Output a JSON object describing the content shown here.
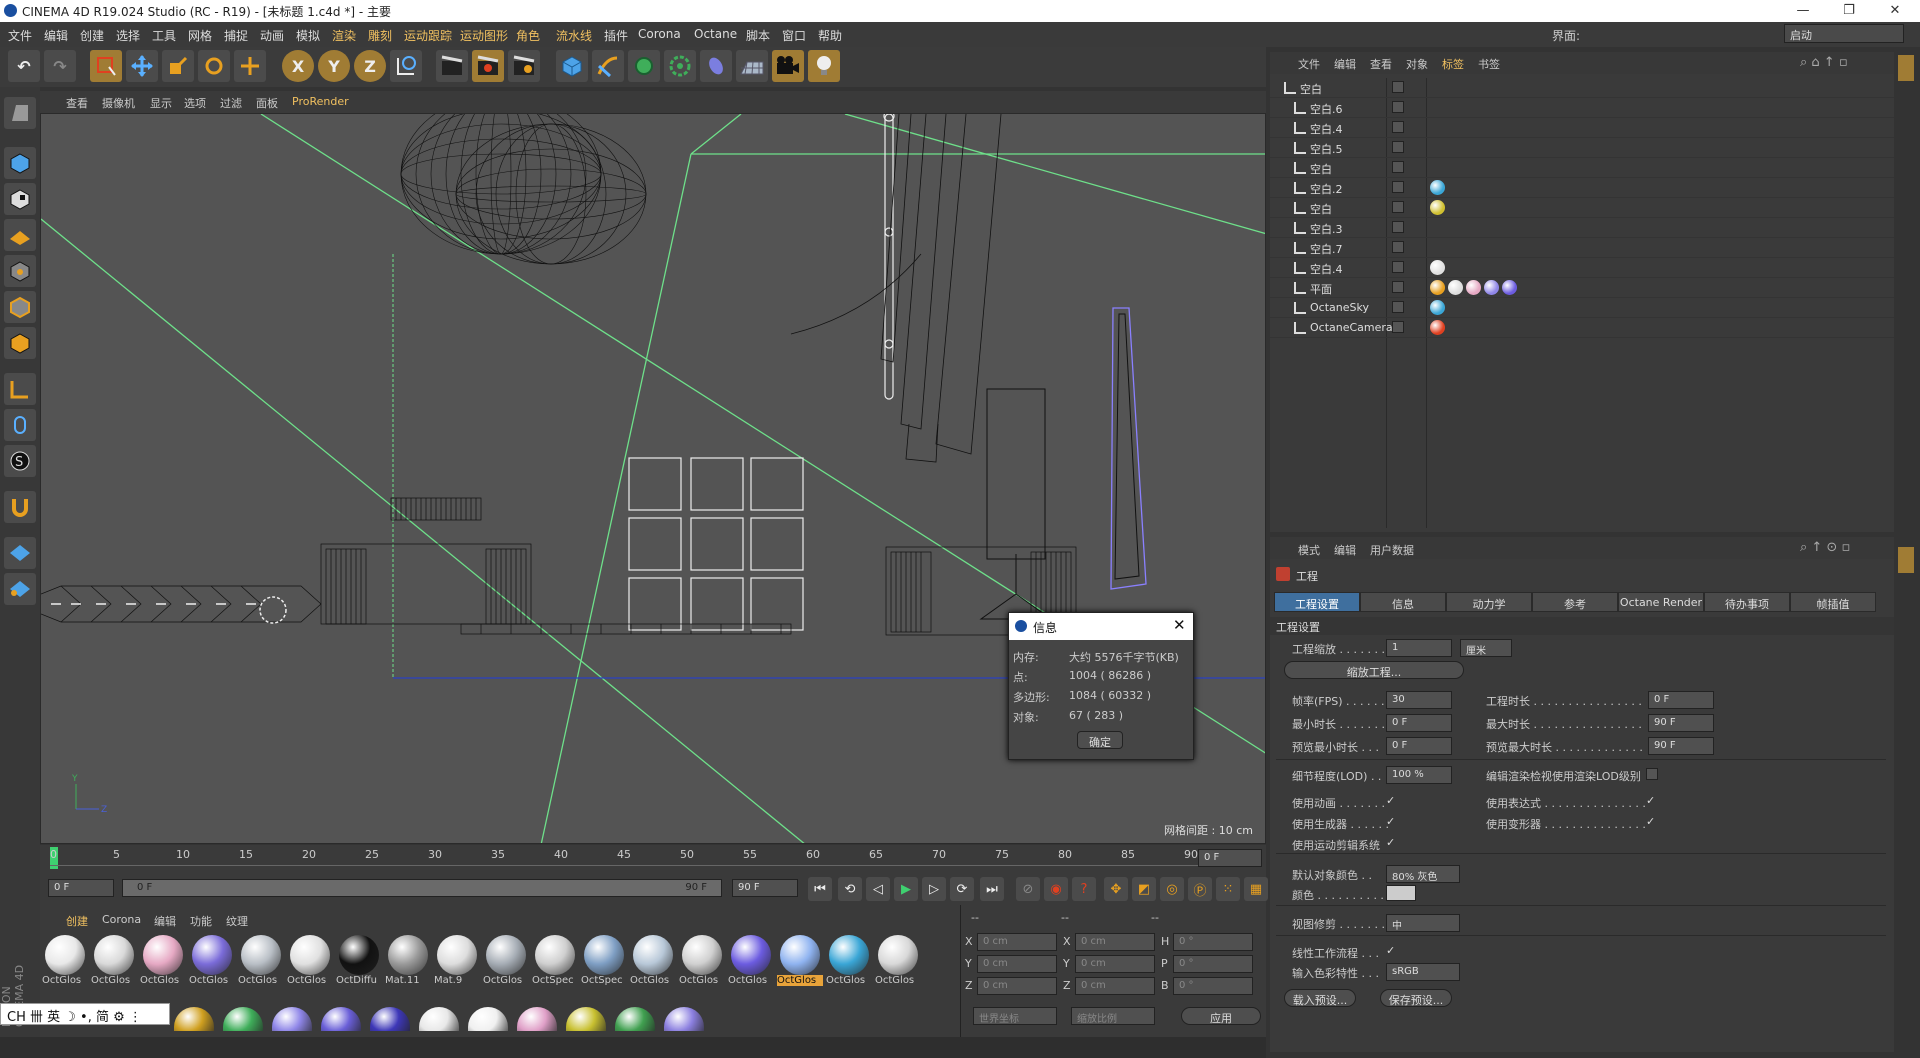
{
  "window": {
    "title": "CINEMA 4D R19.024 Studio (RC - R19) - [未标题 1.c4d *] - 主要",
    "minimize": "—",
    "restore": "❐",
    "close": "✕"
  },
  "menubar": {
    "items": [
      "文件",
      "编辑",
      "创建",
      "选择",
      "工具",
      "网格",
      "捕捉",
      "动画",
      "模拟",
      "渲染",
      "雕刻",
      "运动跟踪",
      "运动图形",
      "角色",
      "流水线",
      "插件",
      "Corona",
      "Octane",
      "脚本",
      "窗口",
      "帮助"
    ],
    "layout_label": "界面:",
    "layout_value": "启动"
  },
  "toolbar": {
    "undo": "↶",
    "redo": "↷",
    "x_axis": "X",
    "y_axis": "Y",
    "z_axis": "Z"
  },
  "viewport": {
    "menu": [
      "查看",
      "摄像机",
      "显示",
      "选项",
      "过滤",
      "面板",
      "ProRender"
    ],
    "grid_spacing": "网格间距 : 10 cm",
    "axis_y": "Y",
    "axis_z": "Z"
  },
  "timeline": {
    "ticks": [
      "0",
      "5",
      "10",
      "15",
      "20",
      "25",
      "30",
      "35",
      "40",
      "45",
      "50",
      "55",
      "60",
      "65",
      "70",
      "75",
      "80",
      "85",
      "90"
    ],
    "current_frame": "0 F",
    "start": "0 F",
    "range_start": "0 F",
    "range_end": "90 F",
    "end": "90 F"
  },
  "material_manager": {
    "tabs": [
      "创建",
      "Corona",
      "编辑",
      "功能",
      "纹理"
    ],
    "materials": [
      {
        "name": "OctGlos",
        "color": "#e8e8e8"
      },
      {
        "name": "OctGlos",
        "color": "#d9d9d9"
      },
      {
        "name": "OctGlos",
        "color": "#e6a9c4"
      },
      {
        "name": "OctGlos",
        "color": "#7b6cd9"
      },
      {
        "name": "OctGlos",
        "color": "#b9bfc6"
      },
      {
        "name": "OctGlos",
        "color": "#e0e0e0"
      },
      {
        "name": "OctDiffu",
        "color": "#111111"
      },
      {
        "name": "Mat.11",
        "color": "#9a9a9a"
      },
      {
        "name": "Mat.9",
        "color": "#dddddd"
      },
      {
        "name": "OctGlos",
        "color": "#a6adb5"
      },
      {
        "name": "OctSpec",
        "color": "#cfcfcf"
      },
      {
        "name": "OctSpec",
        "color": "#7f9fc4"
      },
      {
        "name": "OctGlos",
        "color": "#b8c8d8"
      },
      {
        "name": "OctGlos",
        "color": "#d0d0d0"
      },
      {
        "name": "OctGlos",
        "color": "#6c5ce0"
      },
      {
        "name": "OctGlos",
        "color": "#8fb3f0"
      },
      {
        "name": "OctGlos",
        "color": "#3aa6d6"
      },
      {
        "name": "OctGlos",
        "color": "#d8d8d8"
      }
    ],
    "row2_colors": [
      "#d0a020",
      "#3fae5a",
      "#8f86e8",
      "#6a5fd8",
      "#3d37b8",
      "#e8e8e8",
      "#f0f0f0",
      "#e0a0c8",
      "#c8c030",
      "#40a050",
      "#8c80e0"
    ]
  },
  "coordinates": {
    "headers": [
      "--",
      "--",
      "--"
    ],
    "rows": [
      {
        "a": "X",
        "av": "0 cm",
        "b": "X",
        "bv": "0 cm",
        "c": "H",
        "cv": "0 °"
      },
      {
        "a": "Y",
        "av": "0 cm",
        "b": "Y",
        "bv": "0 cm",
        "c": "P",
        "cv": "0 °"
      },
      {
        "a": "Z",
        "av": "0 cm",
        "b": "Z",
        "bv": "0 cm",
        "c": "B",
        "cv": "0 °"
      }
    ],
    "mode1": "世界坐标",
    "mode2": "缩放比例",
    "apply": "应用"
  },
  "ime": {
    "text": "CH 卌 英 ☽ •, 简 ⚙ ⋮"
  },
  "object_manager": {
    "menu": [
      "文件",
      "编辑",
      "查看",
      "对象",
      "标签",
      "书签"
    ],
    "objects": [
      {
        "name": "空白",
        "depth": 0
      },
      {
        "name": "空白.6",
        "depth": 1
      },
      {
        "name": "空白.4",
        "depth": 1
      },
      {
        "name": "空白.5",
        "depth": 1
      },
      {
        "name": "空白",
        "depth": 1
      },
      {
        "name": "空白.2",
        "depth": 1
      },
      {
        "name": "空白",
        "depth": 1
      },
      {
        "name": "空白.3",
        "depth": 1
      },
      {
        "name": "空白.7",
        "depth": 1
      },
      {
        "name": "空白.4",
        "depth": 1
      },
      {
        "name": "平面",
        "depth": 1
      },
      {
        "name": "OctaneSky",
        "depth": 1
      },
      {
        "name": "OctaneCamera",
        "depth": 1
      }
    ]
  },
  "attribute_manager": {
    "menu": [
      "模式",
      "编辑",
      "用户数据"
    ],
    "title": "工程",
    "tabs": [
      "工程设置",
      "信息",
      "动力学",
      "参考",
      "Octane Render",
      "待办事项",
      "帧插值"
    ],
    "section": "工程设置",
    "scale_label": "工程缩放 . . . . . . . .",
    "scale_value": "1",
    "scale_unit": "厘米",
    "scale_button": "缩放工程...",
    "fps_label": "帧率(FPS) . . . . . .",
    "fps_value": "30",
    "time_label": "工程时长 . . . . . . . . . . . . . . . .",
    "time_value": "0 F",
    "min_label": "最小时长 . . . . . . .",
    "min_value": "0 F",
    "max_label": "最大时长 . . . . . . . . . . . . . . . .",
    "max_value": "90 F",
    "pmin_label": "预览最小时长 . . .",
    "pmin_value": "0 F",
    "pmax_label": "预览最大时长 . . . . . . . . . . . . .",
    "pmax_value": "90 F",
    "lod_label": "细节程度(LOD) . . .",
    "lod_value": "100 %",
    "lod_render_label": "编辑渲染检视使用渲染LOD级别",
    "anim_label": "使用动画 . . . . . . .",
    "expr_label": "使用表达式 . . . . . . . . . . . . . . .",
    "gen_label": "使用生成器 . . . . . .",
    "deform_label": "使用变形器 . . . . . . . . . . . . . . .",
    "motion_label": "使用运动剪辑系统",
    "def_color_label": "默认对象颜色 . .",
    "def_color_value": "80% 灰色",
    "color_label": "颜色 . . . . . . . . . . .",
    "view_clip_label": "视图修剪 . . . . . . .",
    "view_clip_value": "中",
    "linear_label": "线性工作流程 . . .",
    "input_color_label": "输入色彩特性 . . .",
    "input_color_value": "sRGB",
    "load_preset": "载入预设...",
    "save_preset": "保存预设..."
  },
  "dialog": {
    "title": "信息",
    "mem_label": "内存:",
    "mem_value": "大约 5576千字节(KB)",
    "pts_label": "点:",
    "pts_value": "1004 ( 86286 )",
    "poly_label": "多边形:",
    "poly_value": "1084 ( 60332 )",
    "obj_label": "对象:",
    "obj_value": "67 ( 283 )",
    "ok": "确定"
  },
  "brand": "MAXON CINEMA 4D",
  "colors": {
    "accent": "#3f6f9e",
    "highlight": "#e8a33a",
    "grid_line": "#6ee08a"
  }
}
